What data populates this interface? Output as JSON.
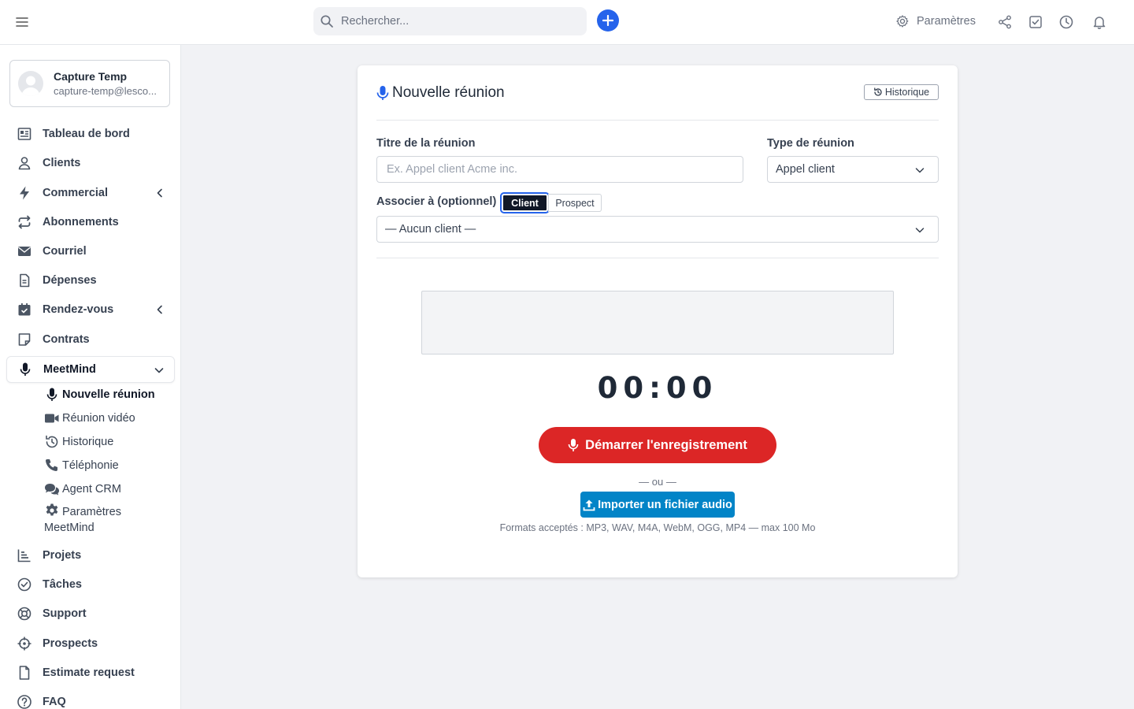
{
  "topbar": {
    "search_placeholder": "Rechercher...",
    "settings_label": "Paramètres"
  },
  "profile": {
    "name": "Capture Temp",
    "email": "capture-temp@lesco..."
  },
  "sidebar": {
    "items": [
      {
        "label": "Tableau de bord",
        "icon": "dashboard-icon"
      },
      {
        "label": "Clients",
        "icon": "user-icon"
      },
      {
        "label": "Commercial",
        "icon": "bolt-icon",
        "chevron": "left"
      },
      {
        "label": "Abonnements",
        "icon": "repeat-icon"
      },
      {
        "label": "Courriel",
        "icon": "envelope-icon"
      },
      {
        "label": "Dépenses",
        "icon": "file-icon"
      },
      {
        "label": "Rendez-vous",
        "icon": "calendar-icon",
        "chevron": "left"
      },
      {
        "label": "Contrats",
        "icon": "contract-icon"
      },
      {
        "label": "MeetMind",
        "icon": "microphone-icon",
        "chevron": "down",
        "active": true
      },
      {
        "label": "Projets",
        "icon": "chart-icon"
      },
      {
        "label": "Tâches",
        "icon": "check-circle-icon"
      },
      {
        "label": "Support",
        "icon": "lifebuoy-icon"
      },
      {
        "label": "Prospects",
        "icon": "crosshair-icon"
      },
      {
        "label": "Estimate request",
        "icon": "document-icon"
      },
      {
        "label": "FAQ",
        "icon": "question-icon"
      }
    ],
    "subitems": [
      {
        "label": "Nouvelle réunion",
        "icon": "microphone-icon",
        "active": true
      },
      {
        "label": "Réunion vidéo",
        "icon": "video-icon"
      },
      {
        "label": "Historique",
        "icon": "history-icon"
      },
      {
        "label": "Téléphonie",
        "icon": "phone-icon"
      },
      {
        "label": "Agent CRM",
        "icon": "chat-icon"
      },
      {
        "label": "Paramètres",
        "label2": "MeetMind",
        "icon": "gear-icon"
      }
    ]
  },
  "card": {
    "title": "Nouvelle réunion",
    "history_button": "Historique",
    "title_label": "Titre de la réunion",
    "title_placeholder": "Ex. Appel client Acme inc.",
    "type_label": "Type de réunion",
    "type_value": "Appel client",
    "associate_label": "Associer à (optionnel)",
    "toggle_client": "Client",
    "toggle_prospect": "Prospect",
    "client_select_value": "— Aucun client —",
    "timer": "00:00",
    "record_button": "Démarrer l'enregistrement",
    "or_text": "— ou —",
    "import_button": "Importer un fichier audio",
    "formats_text": "Formats acceptés : MP3, WAV, M4A, WebM, OGG, MP4 — max 100 Mo"
  },
  "colors": {
    "primary": "#2563eb",
    "record": "#dc2626",
    "import": "#0284c7"
  }
}
